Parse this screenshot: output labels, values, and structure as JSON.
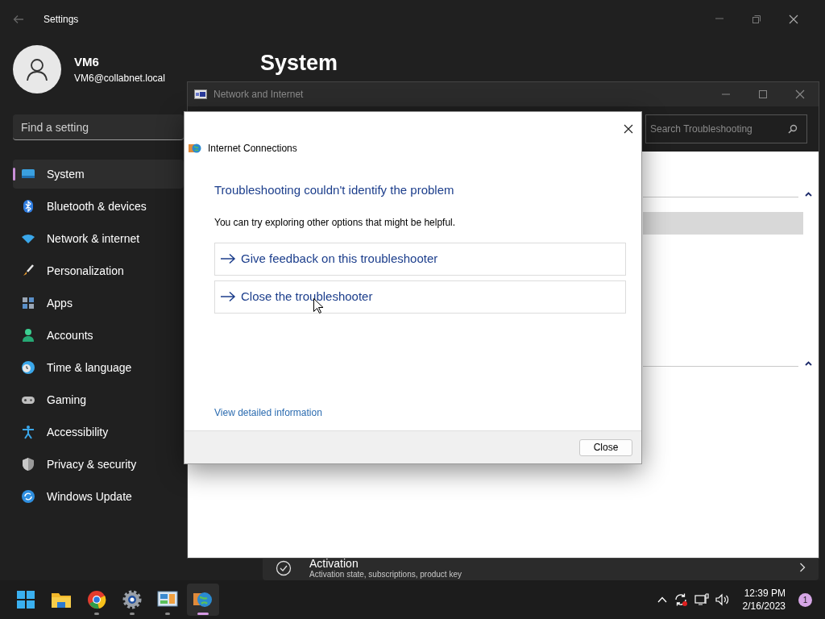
{
  "settings": {
    "title": "Settings",
    "user": {
      "name": "VM6",
      "email": "VM6@collabnet.local"
    },
    "search": {
      "placeholder": "Find a setting"
    },
    "nav": [
      {
        "label": "System",
        "kind": "system",
        "selected": true
      },
      {
        "label": "Bluetooth & devices",
        "kind": "bluetooth",
        "selected": false
      },
      {
        "label": "Network & internet",
        "kind": "network",
        "selected": false
      },
      {
        "label": "Personalization",
        "kind": "brush",
        "selected": false
      },
      {
        "label": "Apps",
        "kind": "apps",
        "selected": false
      },
      {
        "label": "Accounts",
        "kind": "accounts",
        "selected": false
      },
      {
        "label": "Time & language",
        "kind": "time",
        "selected": false
      },
      {
        "label": "Gaming",
        "kind": "gaming",
        "selected": false
      },
      {
        "label": "Accessibility",
        "kind": "accessibility",
        "selected": false
      },
      {
        "label": "Privacy & security",
        "kind": "shield",
        "selected": false
      },
      {
        "label": "Windows Update",
        "kind": "update",
        "selected": false
      }
    ],
    "page_title": "System",
    "activation": {
      "title": "Activation",
      "subtitle": "Activation state, subscriptions, product key"
    }
  },
  "network_window": {
    "title": "Network and Internet",
    "search": {
      "placeholder": "Search Troubleshooting"
    }
  },
  "dialog": {
    "title": "Internet Connections",
    "heading": "Troubleshooting couldn't identify the problem",
    "message": "You can try exploring other options that might be helpful.",
    "options": [
      "Give feedback on this troubleshooter",
      "Close the troubleshooter"
    ],
    "details_link": "View detailed information",
    "close_button": "Close"
  },
  "taskbar": {
    "apps": [
      {
        "kind": "start",
        "running": false,
        "active": false
      },
      {
        "kind": "folder",
        "running": false,
        "active": false
      },
      {
        "kind": "browser",
        "running": true,
        "active": false
      },
      {
        "kind": "gear",
        "running": true,
        "active": false
      },
      {
        "kind": "panel",
        "running": true,
        "active": false
      },
      {
        "kind": "globe",
        "running": true,
        "active": true
      }
    ],
    "time": "12:39 PM",
    "date": "2/16/2023",
    "notifications": "1"
  }
}
